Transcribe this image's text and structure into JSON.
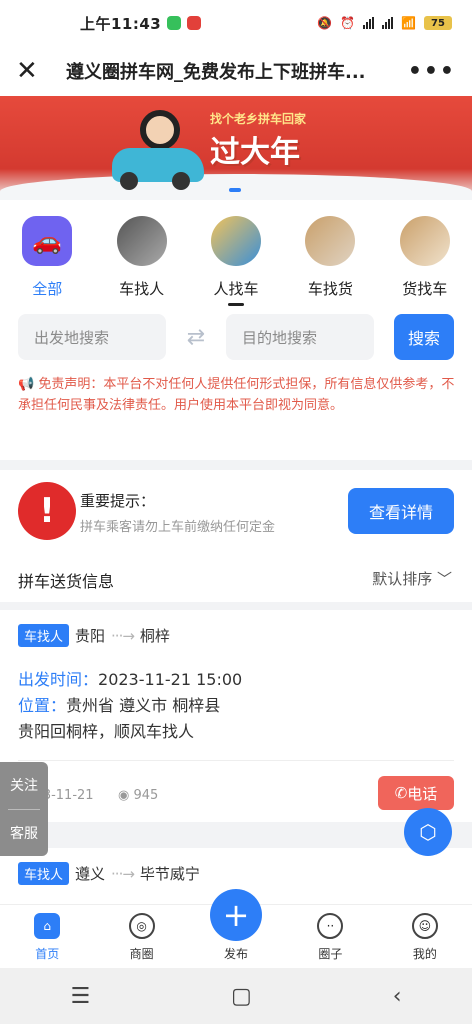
{
  "status_bar": {
    "time": "上午11:43",
    "battery": "75"
  },
  "title_bar": {
    "title": "遵义圈拼车网_免费发布上下班拼车...",
    "close_icon": "close-icon",
    "more_icon": "more-icon"
  },
  "banner": {
    "slogan_small": "找个老乡拼车回家",
    "slogan_big": "过大年"
  },
  "categories": [
    {
      "label": "全部",
      "icon": "car-icon",
      "active": true
    },
    {
      "label": "车找人"
    },
    {
      "label": "人找车"
    },
    {
      "label": "车找货"
    },
    {
      "label": "货找车"
    }
  ],
  "search": {
    "from_placeholder": "出发地搜索",
    "to_placeholder": "目的地搜索",
    "button": "搜索"
  },
  "disclaimer": "免责声明：本平台不对任何人提供任何形式担保，所有信息仅供参考，不承担任何民事及法律责任。用户使用本平台即视为同意。",
  "notice": {
    "title": "重要提示：",
    "subtitle": "拼车乘客请勿上车前缴纳任何定金",
    "button": "查看详情"
  },
  "list_header": {
    "title": "拼车送货信息",
    "sort": "默认排序"
  },
  "listings": [
    {
      "tag": "车找人",
      "from": "贵阳",
      "to": "桐梓",
      "depart_label": "出发时间：",
      "depart_time": "2023-11-21 15:00",
      "location_label": "位置：",
      "location": "贵州省 遵义市 桐梓县",
      "desc": "贵阳回桐梓，顺风车找人",
      "date": "2023-11-21",
      "views": "945",
      "call": "电话"
    },
    {
      "tag": "车找人",
      "from": "遵义",
      "to": "毕节威宁"
    }
  ],
  "side_float": {
    "follow": "关注",
    "service": "客服"
  },
  "tabbar": [
    {
      "label": "首页",
      "active": true
    },
    {
      "label": "商圈"
    },
    {
      "label": "发布"
    },
    {
      "label": "圈子"
    },
    {
      "label": "我的"
    }
  ],
  "accent_color": "#2d7ef7"
}
